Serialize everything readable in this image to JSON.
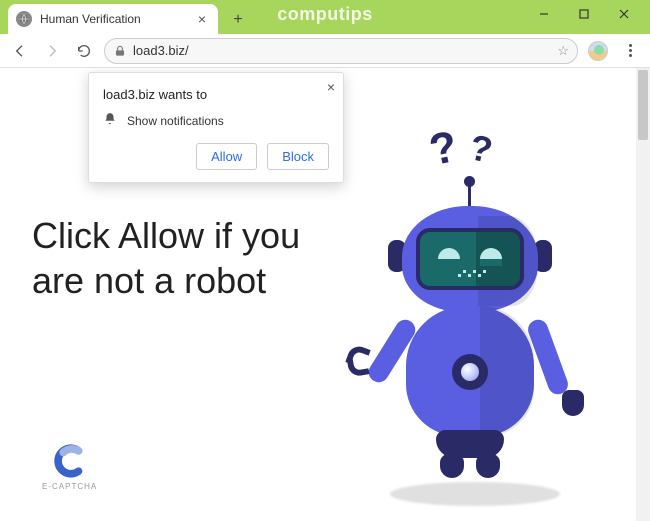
{
  "window": {
    "brand": "computips"
  },
  "tab": {
    "title": "Human Verification"
  },
  "omnibox": {
    "url": "load3.biz/"
  },
  "permission": {
    "title": "load3.biz wants to",
    "request": "Show notifications",
    "allow": "Allow",
    "block": "Block"
  },
  "page": {
    "headline": "Click Allow if you are not a robot",
    "captcha_brand": "E-CAPTCHA",
    "question_mark_1": "?",
    "question_mark_2": "?"
  }
}
